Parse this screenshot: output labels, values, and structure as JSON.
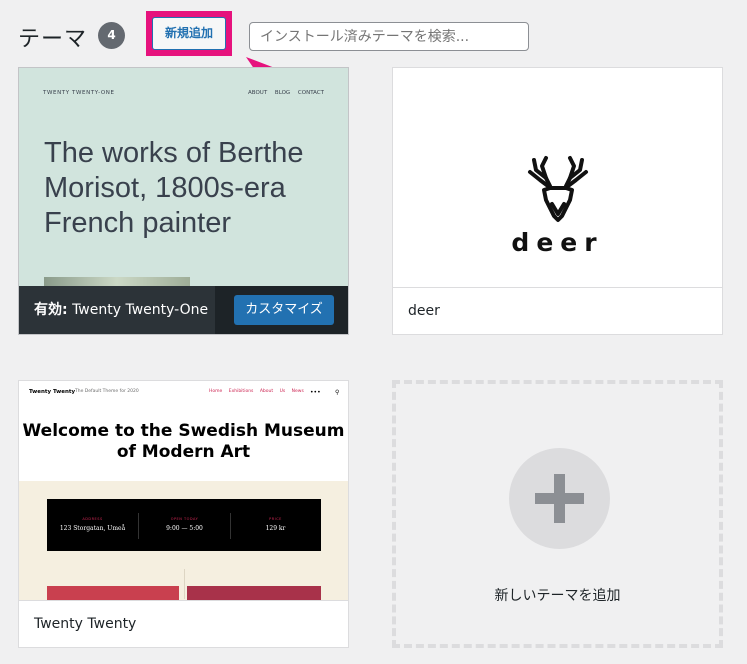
{
  "header": {
    "title": "テーマ",
    "count": "4",
    "add_new_label": "新規追加",
    "search_placeholder": "インストール済みテーマを検索..."
  },
  "themes": [
    {
      "name": "Twenty Twenty-One",
      "active": true,
      "active_prefix": "有効:",
      "customize_label": "カスタマイズ",
      "preview": {
        "brand": "TWENTY TWENTY-ONE",
        "nav": "ABOUT BLOG CONTACT",
        "headline": "The works of Berthe Morisot, 1800s-era French painter"
      }
    },
    {
      "name": "deer",
      "active": false,
      "preview": {
        "wordmark": "deer"
      }
    },
    {
      "name": "Twenty Twenty",
      "active": false,
      "preview": {
        "brand": "Twenty Twenty",
        "tagline": "The Default Theme for 2020",
        "nav": "Home Exhibitions About Us News",
        "headline": "Welcome to the Swedish Museum of Modern Art",
        "info": [
          {
            "label": "ADDRESS",
            "value": "123 Storgatan, Umeå"
          },
          {
            "label": "OPEN TODAY",
            "value": "9:00 — 5:00"
          },
          {
            "label": "PRICE",
            "value": "129 kr"
          }
        ]
      }
    }
  ],
  "add_new_card": {
    "label": "新しいテーマを追加"
  },
  "colors": {
    "accent": "#2271b1",
    "highlight": "#e6127d",
    "active_bar": "#1d2327",
    "t21_bg": "#d1e4dd"
  }
}
